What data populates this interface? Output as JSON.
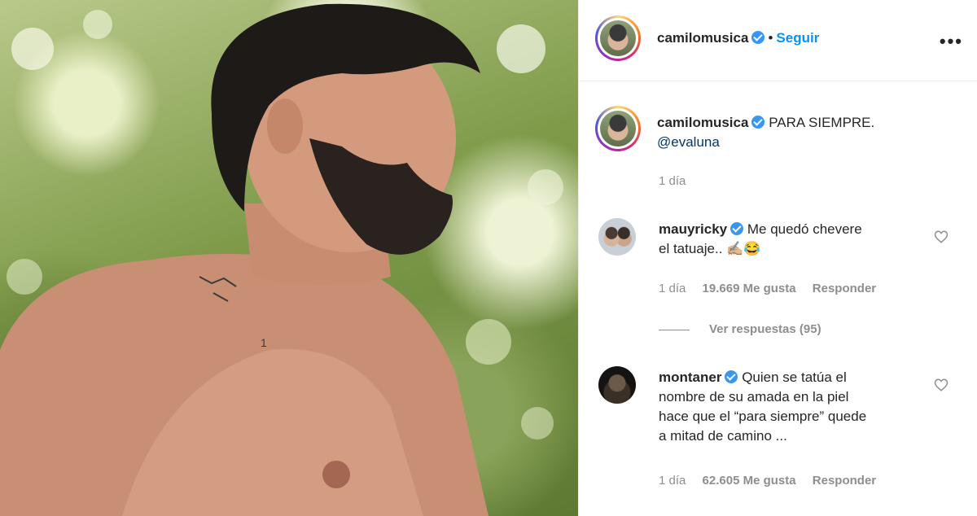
{
  "post": {
    "author": "camilomusica",
    "follow_label": "Seguir",
    "caption": "PARA SIEMPRE.",
    "mention": "@evaluna",
    "time": "1 día"
  },
  "comments": [
    {
      "user": "mauyricky",
      "line1": "Me quedó chevere",
      "line2": "el tatuaje.. ✍🏼😂",
      "time": "1 día",
      "likes": "19.669 Me gusta",
      "reply": "Responder",
      "view_replies": "Ver respuestas (95)"
    },
    {
      "user": "montaner",
      "line1": "Quien se tatúa el",
      "line2": "nombre de su amada en la piel",
      "line3": "hace que el “para siempre” quede",
      "line4": "a mitad de camino ...",
      "time": "1 día",
      "likes": "62.605 Me gusta",
      "reply": "Responder"
    }
  ],
  "colors": {
    "link_blue": "#0095f6",
    "verified_blue": "#3897f0",
    "muted": "#8e8e8e"
  }
}
